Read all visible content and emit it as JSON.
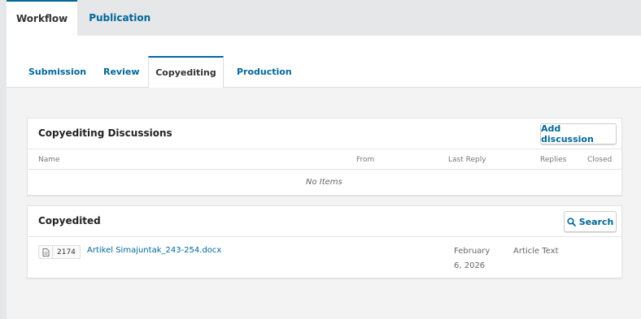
{
  "top_tabs": [
    {
      "label": "Workflow"
    },
    {
      "label": "Publication"
    }
  ],
  "sub_tabs": [
    {
      "label": "Submission"
    },
    {
      "label": "Review"
    },
    {
      "label": "Copyediting"
    },
    {
      "label": "Production"
    }
  ],
  "discussions": {
    "title": "Copyediting Discussions",
    "add_label": "Add discussion",
    "columns": {
      "name": "Name",
      "from": "From",
      "last_reply": "Last Reply",
      "replies": "Replies",
      "closed": "Closed"
    },
    "empty_text": "No Items"
  },
  "copyedited": {
    "title": "Copyedited",
    "search_label": "Search",
    "files": [
      {
        "id": "2174",
        "name": "Artikel Simajuntak_243-254.docx",
        "date_line1": "February",
        "date_line2": "6, 2026",
        "type": "Article Text"
      }
    ]
  },
  "colors": {
    "accent": "#006798",
    "background": "#e6e7e9"
  }
}
